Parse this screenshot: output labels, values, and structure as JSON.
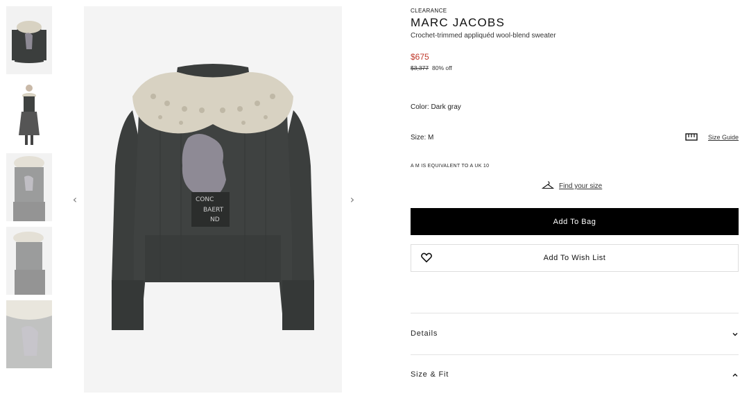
{
  "gallery": {
    "prev_arrow": "‹",
    "next_arrow": "›"
  },
  "product": {
    "badge": "CLEARANCE",
    "brand": "MARC JACOBS",
    "description": "Crochet-trimmed appliquéd wool-blend sweater",
    "price": "$675",
    "original_price": "$3,377",
    "discount": "80% off",
    "color_line": "Color: Dark gray",
    "size_line": "Size: M",
    "size_guide_label": "Size Guide",
    "equivalence_note": "A M IS EQUIVALENT TO A UK 10",
    "find_size_label": "Find your size"
  },
  "actions": {
    "add_to_bag": "Add To Bag",
    "add_to_wishlist": "Add To Wish List"
  },
  "accordion": [
    {
      "label": "Details",
      "state": "collapsed",
      "chevron": "chevron-down-icon"
    },
    {
      "label": "Size & Fit",
      "state": "expanded",
      "chevron": "chevron-up-icon"
    }
  ],
  "colors": {
    "price_red": "#c0392b",
    "button_black": "#000000",
    "sweater_gray": "#3a3d3c",
    "collar_cream": "#d8d2c2"
  }
}
